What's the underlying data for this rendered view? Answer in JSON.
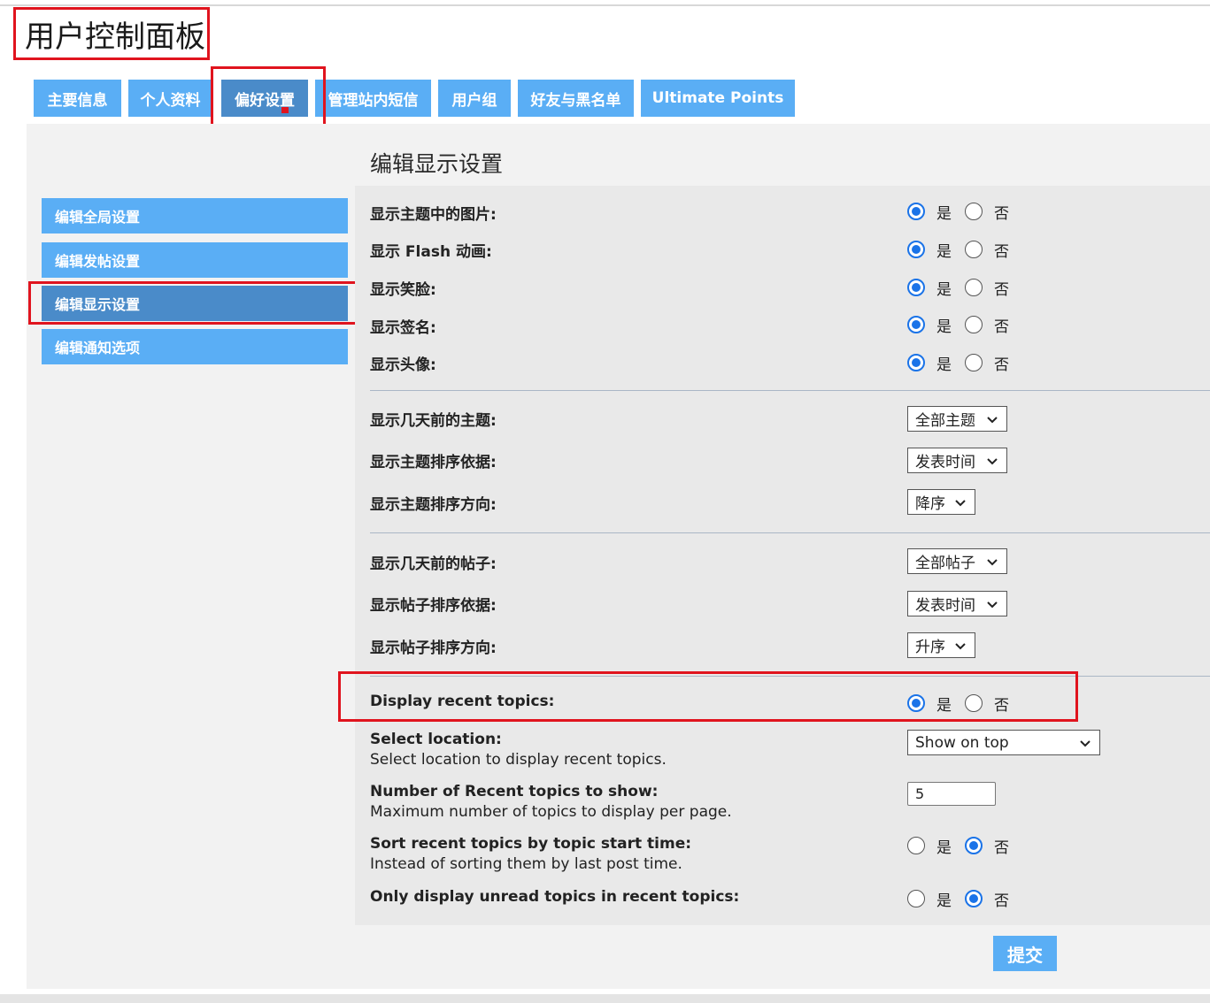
{
  "page_title": "用户控制面板",
  "tabs": [
    {
      "label": "主要信息"
    },
    {
      "label": "个人资料"
    },
    {
      "label": "偏好设置"
    },
    {
      "label": "管理站内短信"
    },
    {
      "label": "用户组"
    },
    {
      "label": "好友与黑名单"
    },
    {
      "label": "Ultimate Points"
    }
  ],
  "active_tab": "偏好设置",
  "sidebar": {
    "items": [
      {
        "label": "编辑全局设置"
      },
      {
        "label": "编辑发帖设置"
      },
      {
        "label": "编辑显示设置"
      },
      {
        "label": "编辑通知选项"
      }
    ],
    "active": "编辑显示设置"
  },
  "section_title": "编辑显示设置",
  "yes_label": "是",
  "no_label": "否",
  "radio_settings": [
    {
      "label": "显示主题中的图片:",
      "value": "是"
    },
    {
      "label": "显示 Flash 动画:",
      "value": "是"
    },
    {
      "label": "显示笑脸:",
      "value": "是"
    },
    {
      "label": "显示签名:",
      "value": "是"
    },
    {
      "label": "显示头像:",
      "value": "是"
    }
  ],
  "topic_settings": [
    {
      "label": "显示几天前的主题:",
      "selected": "全部主题"
    },
    {
      "label": "显示主题排序依据:",
      "selected": "发表时间"
    },
    {
      "label": "显示主题排序方向:",
      "selected": "降序"
    }
  ],
  "post_settings": [
    {
      "label": "显示几天前的帖子:",
      "selected": "全部帖子"
    },
    {
      "label": "显示帖子排序依据:",
      "selected": "发表时间"
    },
    {
      "label": "显示帖子排序方向:",
      "selected": "升序"
    }
  ],
  "recent_topics": {
    "display": {
      "label": "Display recent topics:",
      "value": "是"
    },
    "location": {
      "label": "Select location:",
      "desc": "Select location to display recent topics.",
      "selected": "Show on top"
    },
    "number": {
      "label": "Number of Recent topics to show:",
      "desc": "Maximum number of topics to display per page.",
      "value": "5"
    },
    "sort": {
      "label": "Sort recent topics by topic start time:",
      "desc": "Instead of sorting them by last post time.",
      "value": "否"
    },
    "unread": {
      "label": "Only display unread topics in recent topics:",
      "value": "否"
    }
  },
  "submit_label": "提交",
  "colors": {
    "tab": "#5aaef5",
    "tab_active": "#4a8bc9",
    "radio_on": "#1a73e8",
    "highlight": "#e0141e"
  }
}
